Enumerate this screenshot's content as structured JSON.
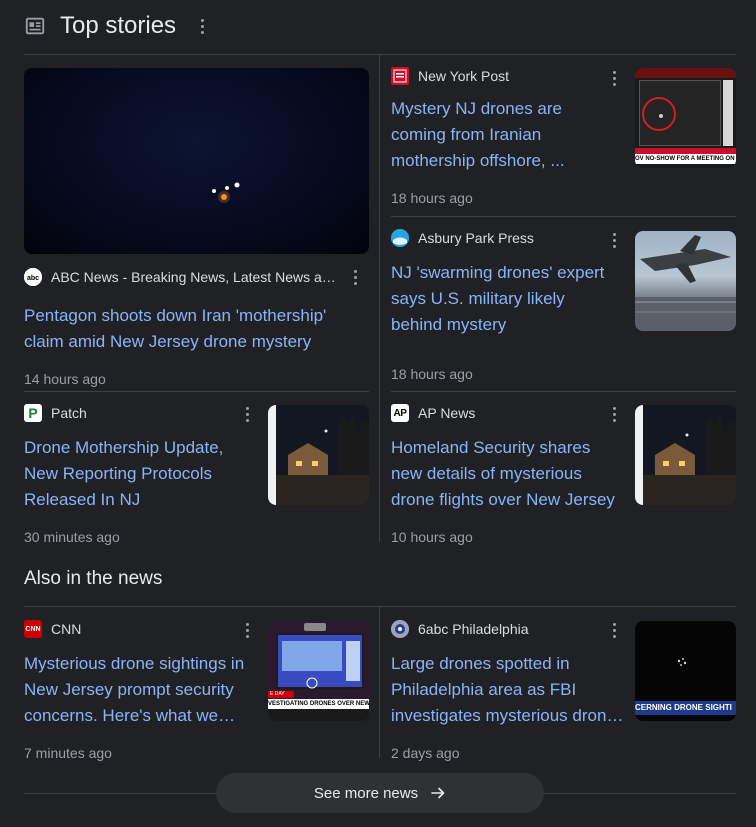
{
  "top_stories": {
    "title": "Top stories",
    "stories": [
      {
        "source": "ABC News - Breaking News, Latest News and Videos",
        "headline": "Pentagon shoots down Iran 'mothership' claim amid New Jersey drone mystery",
        "time": "14 hours ago",
        "logo_icon": "abc-logo"
      },
      {
        "source": "New York Post",
        "headline": "Mystery NJ drones are coming from Iranian mothership offshore, ...",
        "time": "18 hours ago",
        "logo_icon": "nypost-logo",
        "thumb_caption": "OV NO-SHOW FOR A MEETING ON MYST"
      },
      {
        "source": "Asbury Park Press",
        "headline": "NJ 'swarming drones' expert says U.S. military likely behind mystery",
        "time": "18 hours ago",
        "logo_icon": "app-logo"
      },
      {
        "source": "Patch",
        "headline": "Drone Mothership Update, New Reporting Protocols Released In NJ",
        "time": "30 minutes ago",
        "logo_icon": "patch-logo",
        "logo_letter": "P"
      },
      {
        "source": "AP News",
        "headline": "Homeland Security shares new details of mysterious drone flights over New Jersey",
        "time": "10 hours ago",
        "logo_icon": "ap-logo",
        "logo_letter": "AP"
      }
    ]
  },
  "also_in_news": {
    "title": "Also in the news",
    "stories": [
      {
        "source": "CNN",
        "headline": "Mysterious drone sightings in New Jersey prompt security concerns. Here's what we know",
        "time": "7 minutes ago",
        "logo_icon": "cnn-logo",
        "logo_letter": "CNN",
        "thumb_caption": "VESTIGATING DRONES OVER NEW JERSE",
        "thumb_tag": "E DAY"
      },
      {
        "source": "6abc Philadelphia",
        "headline": "Large drones spotted in Philadelphia area as FBI investigates mysterious drone sightings",
        "time": "2 days ago",
        "logo_icon": "6abc-logo",
        "thumb_caption": "CERNING DRONE SIGHTI"
      }
    ]
  },
  "see_more": {
    "label": "See more news"
  },
  "colors": {
    "background": "#202124",
    "link": "#8ab4f8",
    "muted": "#9aa0a6",
    "divider": "#3c4043"
  }
}
